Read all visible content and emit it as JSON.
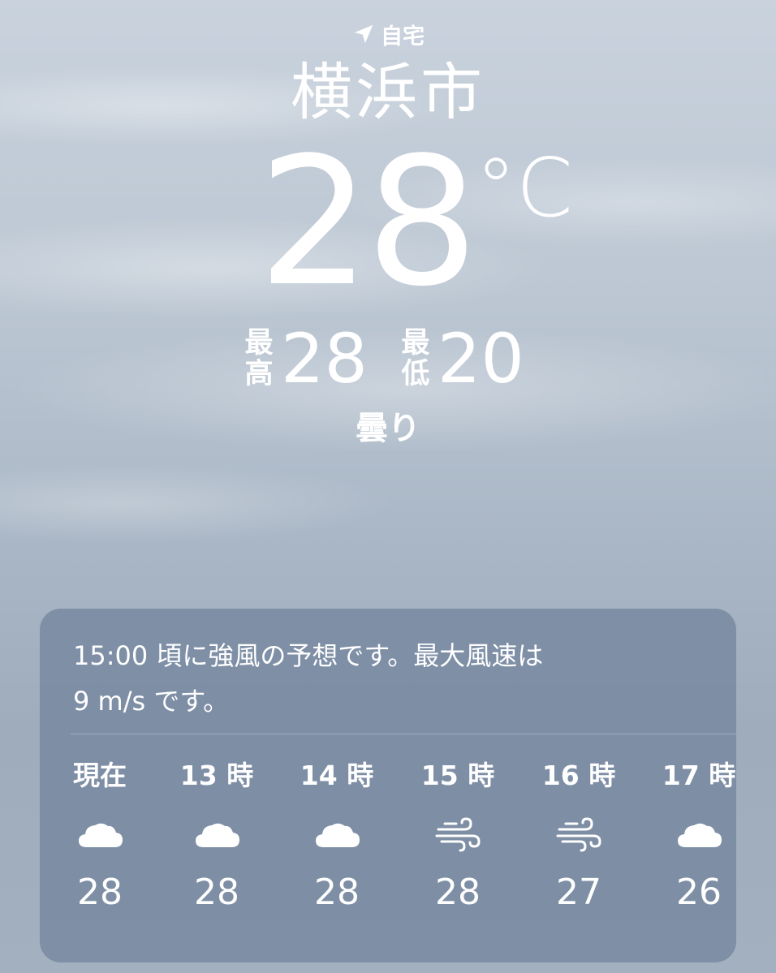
{
  "header": {
    "location_label": "自宅",
    "city": "横浜市",
    "temperature": "28",
    "unit": "°C",
    "high_label_1": "最",
    "high_label_2": "高",
    "high": "28",
    "low_label_1": "最",
    "low_label_2": "低",
    "low": "20",
    "condition": "曇り"
  },
  "forecast": {
    "alert_line_1": "15:00 頃に強風の予想です。最大風速は",
    "alert_line_2": "9 m/s です。",
    "hours": [
      {
        "time": "現在",
        "icon": "cloud-icon",
        "temp": "28"
      },
      {
        "time": "13 時",
        "icon": "cloud-icon",
        "temp": "28"
      },
      {
        "time": "14 時",
        "icon": "cloud-icon",
        "temp": "28"
      },
      {
        "time": "15 時",
        "icon": "wind-icon",
        "temp": "28"
      },
      {
        "time": "16 時",
        "icon": "wind-icon",
        "temp": "27"
      },
      {
        "time": "17 時",
        "icon": "cloud-icon",
        "temp": "26"
      }
    ]
  }
}
